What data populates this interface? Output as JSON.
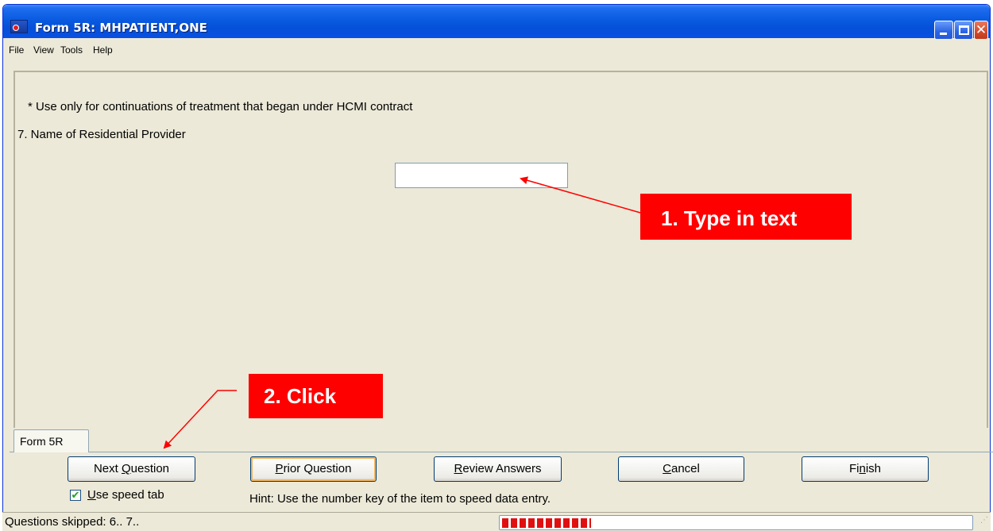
{
  "window": {
    "title": "Form 5R: MHPATIENT,ONE"
  },
  "menu": {
    "items": [
      "File",
      "View",
      "Tools",
      "Help"
    ]
  },
  "form": {
    "note": "* Use only for continuations of treatment that began under HCMI contract",
    "question": "7. Name of Residential Provider",
    "answer_value": ""
  },
  "tabs": [
    "Form 5R"
  ],
  "buttons": {
    "next": "Next Question",
    "prior": "Prior Question",
    "review": "Review Answers",
    "cancel": "Cancel",
    "finish": "Finish"
  },
  "options": {
    "speed_tab_label": "Use speed tab",
    "speed_tab_checked": true,
    "check_glyph": "✔"
  },
  "hint": "Hint: Use the number key of the item to speed data entry.",
  "status": {
    "text": "Questions skipped: 6.. 7..",
    "progress_fraction": 0.19
  },
  "annotations": {
    "callout_1": "1. Type in text",
    "callout_2": "2. Click"
  },
  "colors": {
    "callout": "#ff0000",
    "progress": "#e01010",
    "titlebar": "#0a5be0"
  }
}
